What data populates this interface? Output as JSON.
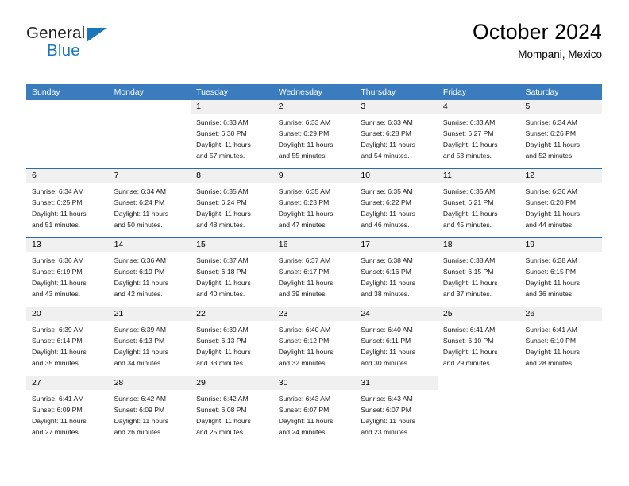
{
  "brand": {
    "name_top": "General",
    "name_bottom": "Blue",
    "triangle_color": "#1b75bb",
    "text_color": "#231f20"
  },
  "header": {
    "title": "October 2024",
    "subtitle": "Mompani, Mexico"
  },
  "theme": {
    "header_blue": "#3a7cbe",
    "divider_blue": "#2e6da4",
    "daynum_band": "#f0f0f0",
    "text": "#000000"
  },
  "weekdays": [
    "Sunday",
    "Monday",
    "Tuesday",
    "Wednesday",
    "Thursday",
    "Friday",
    "Saturday"
  ],
  "weeks": [
    [
      {
        "day": "",
        "blank": true,
        "lines": []
      },
      {
        "day": "",
        "blank": true,
        "lines": []
      },
      {
        "day": "1",
        "lines": [
          "Sunrise: 6:33 AM",
          "Sunset: 6:30 PM",
          "Daylight: 11 hours",
          "and 57 minutes."
        ]
      },
      {
        "day": "2",
        "lines": [
          "Sunrise: 6:33 AM",
          "Sunset: 6:29 PM",
          "Daylight: 11 hours",
          "and 55 minutes."
        ]
      },
      {
        "day": "3",
        "lines": [
          "Sunrise: 6:33 AM",
          "Sunset: 6:28 PM",
          "Daylight: 11 hours",
          "and 54 minutes."
        ]
      },
      {
        "day": "4",
        "lines": [
          "Sunrise: 6:33 AM",
          "Sunset: 6:27 PM",
          "Daylight: 11 hours",
          "and 53 minutes."
        ]
      },
      {
        "day": "5",
        "lines": [
          "Sunrise: 6:34 AM",
          "Sunset: 6:26 PM",
          "Daylight: 11 hours",
          "and 52 minutes."
        ]
      }
    ],
    [
      {
        "day": "6",
        "lines": [
          "Sunrise: 6:34 AM",
          "Sunset: 6:25 PM",
          "Daylight: 11 hours",
          "and 51 minutes."
        ]
      },
      {
        "day": "7",
        "lines": [
          "Sunrise: 6:34 AM",
          "Sunset: 6:24 PM",
          "Daylight: 11 hours",
          "and 50 minutes."
        ]
      },
      {
        "day": "8",
        "lines": [
          "Sunrise: 6:35 AM",
          "Sunset: 6:24 PM",
          "Daylight: 11 hours",
          "and 48 minutes."
        ]
      },
      {
        "day": "9",
        "lines": [
          "Sunrise: 6:35 AM",
          "Sunset: 6:23 PM",
          "Daylight: 11 hours",
          "and 47 minutes."
        ]
      },
      {
        "day": "10",
        "lines": [
          "Sunrise: 6:35 AM",
          "Sunset: 6:22 PM",
          "Daylight: 11 hours",
          "and 46 minutes."
        ]
      },
      {
        "day": "11",
        "lines": [
          "Sunrise: 6:35 AM",
          "Sunset: 6:21 PM",
          "Daylight: 11 hours",
          "and 45 minutes."
        ]
      },
      {
        "day": "12",
        "lines": [
          "Sunrise: 6:36 AM",
          "Sunset: 6:20 PM",
          "Daylight: 11 hours",
          "and 44 minutes."
        ]
      }
    ],
    [
      {
        "day": "13",
        "lines": [
          "Sunrise: 6:36 AM",
          "Sunset: 6:19 PM",
          "Daylight: 11 hours",
          "and 43 minutes."
        ]
      },
      {
        "day": "14",
        "lines": [
          "Sunrise: 6:36 AM",
          "Sunset: 6:19 PM",
          "Daylight: 11 hours",
          "and 42 minutes."
        ]
      },
      {
        "day": "15",
        "lines": [
          "Sunrise: 6:37 AM",
          "Sunset: 6:18 PM",
          "Daylight: 11 hours",
          "and 40 minutes."
        ]
      },
      {
        "day": "16",
        "lines": [
          "Sunrise: 6:37 AM",
          "Sunset: 6:17 PM",
          "Daylight: 11 hours",
          "and 39 minutes."
        ]
      },
      {
        "day": "17",
        "lines": [
          "Sunrise: 6:38 AM",
          "Sunset: 6:16 PM",
          "Daylight: 11 hours",
          "and 38 minutes."
        ]
      },
      {
        "day": "18",
        "lines": [
          "Sunrise: 6:38 AM",
          "Sunset: 6:15 PM",
          "Daylight: 11 hours",
          "and 37 minutes."
        ]
      },
      {
        "day": "19",
        "lines": [
          "Sunrise: 6:38 AM",
          "Sunset: 6:15 PM",
          "Daylight: 11 hours",
          "and 36 minutes."
        ]
      }
    ],
    [
      {
        "day": "20",
        "lines": [
          "Sunrise: 6:39 AM",
          "Sunset: 6:14 PM",
          "Daylight: 11 hours",
          "and 35 minutes."
        ]
      },
      {
        "day": "21",
        "lines": [
          "Sunrise: 6:39 AM",
          "Sunset: 6:13 PM",
          "Daylight: 11 hours",
          "and 34 minutes."
        ]
      },
      {
        "day": "22",
        "lines": [
          "Sunrise: 6:39 AM",
          "Sunset: 6:13 PM",
          "Daylight: 11 hours",
          "and 33 minutes."
        ]
      },
      {
        "day": "23",
        "lines": [
          "Sunrise: 6:40 AM",
          "Sunset: 6:12 PM",
          "Daylight: 11 hours",
          "and 32 minutes."
        ]
      },
      {
        "day": "24",
        "lines": [
          "Sunrise: 6:40 AM",
          "Sunset: 6:11 PM",
          "Daylight: 11 hours",
          "and 30 minutes."
        ]
      },
      {
        "day": "25",
        "lines": [
          "Sunrise: 6:41 AM",
          "Sunset: 6:10 PM",
          "Daylight: 11 hours",
          "and 29 minutes."
        ]
      },
      {
        "day": "26",
        "lines": [
          "Sunrise: 6:41 AM",
          "Sunset: 6:10 PM",
          "Daylight: 11 hours",
          "and 28 minutes."
        ]
      }
    ],
    [
      {
        "day": "27",
        "lines": [
          "Sunrise: 6:41 AM",
          "Sunset: 6:09 PM",
          "Daylight: 11 hours",
          "and 27 minutes."
        ]
      },
      {
        "day": "28",
        "lines": [
          "Sunrise: 6:42 AM",
          "Sunset: 6:09 PM",
          "Daylight: 11 hours",
          "and 26 minutes."
        ]
      },
      {
        "day": "29",
        "lines": [
          "Sunrise: 6:42 AM",
          "Sunset: 6:08 PM",
          "Daylight: 11 hours",
          "and 25 minutes."
        ]
      },
      {
        "day": "30",
        "lines": [
          "Sunrise: 6:43 AM",
          "Sunset: 6:07 PM",
          "Daylight: 11 hours",
          "and 24 minutes."
        ]
      },
      {
        "day": "31",
        "lines": [
          "Sunrise: 6:43 AM",
          "Sunset: 6:07 PM",
          "Daylight: 11 hours",
          "and 23 minutes."
        ]
      },
      {
        "day": "",
        "blank": true,
        "lines": []
      },
      {
        "day": "",
        "blank": true,
        "lines": []
      }
    ]
  ]
}
